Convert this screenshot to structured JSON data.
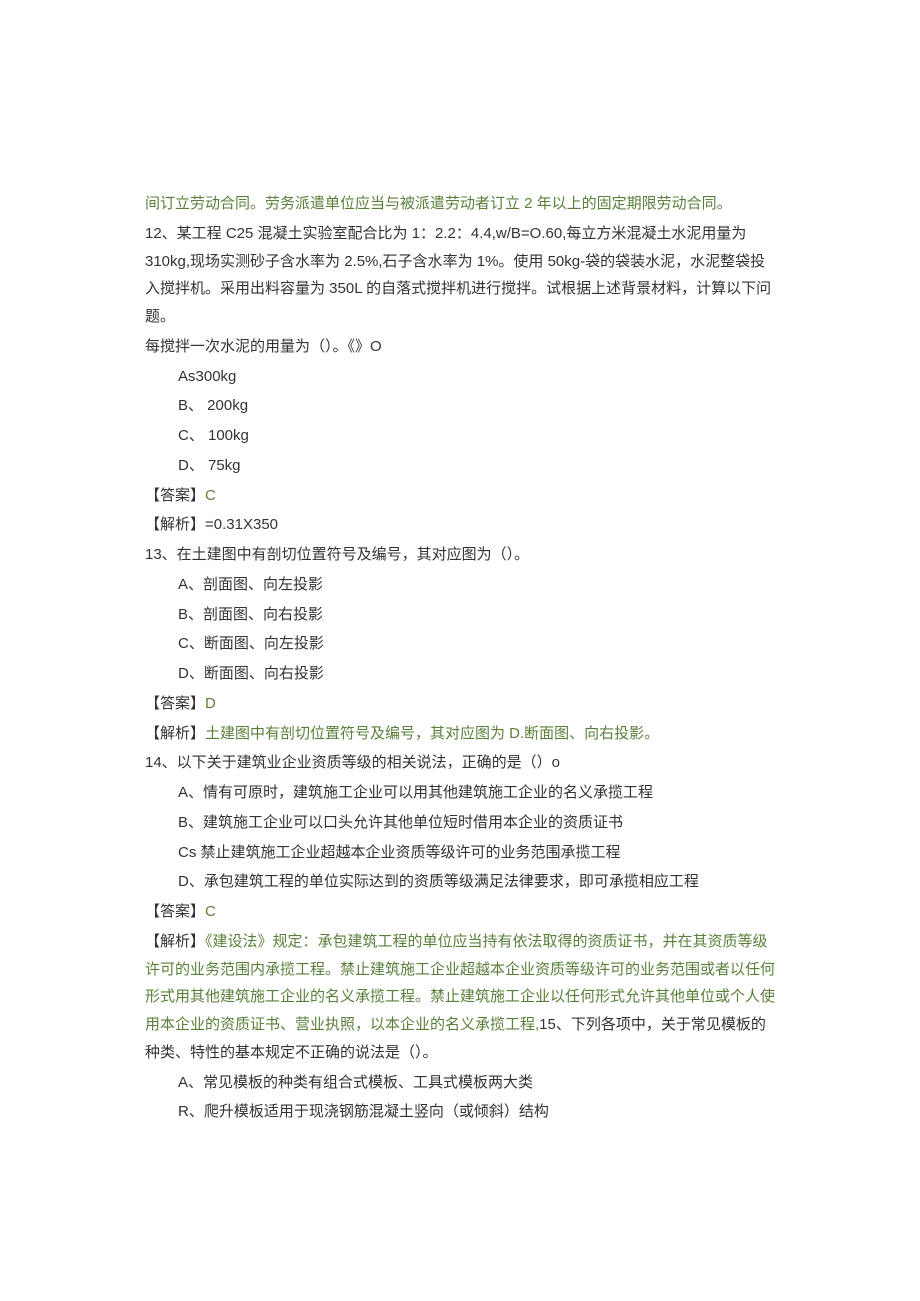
{
  "lines": [
    {
      "cls": "green block",
      "text": "间订立劳动合同。劳务派遣单位应当与被派遣劳动者订立 2 年以上的固定期限劳动合同。"
    },
    {
      "cls": "black block",
      "text": "12、某工程 C25 混凝土实验室配合比为 1：2.2：4.4,w/B=O.60,每立方米混凝土水泥用量为 310kg,现场实测砂子含水率为 2.5%,石子含水率为 1%。使用 50kg-袋的袋装水泥，水泥整袋投入搅拌机。采用出料容量为 350L 的自落式搅拌机进行搅拌。试根据上述背景材料，计算以下问题。"
    },
    {
      "cls": "black block",
      "text": "每搅拌一次水泥的用量为（）。《》O"
    },
    {
      "cls": "black block opt-indent",
      "text": "As300kg"
    },
    {
      "cls": "black block opt-indent",
      "text": "B、 200kg"
    },
    {
      "cls": "black block opt-indent",
      "text": "C、 100kg"
    },
    {
      "cls": "black block opt-indent",
      "text": "D、 75kg"
    },
    {
      "cls": "black block",
      "text": "【答案】",
      "tail": "C",
      "tailCls": "green"
    },
    {
      "cls": "black block",
      "text": "【解析】",
      "tail": "=0.31X350",
      "tailCls": "black"
    },
    {
      "cls": "black block",
      "text": "13、在土建图中有剖切位置符号及编号，其对应图为（）。"
    },
    {
      "cls": "black block opt-indent",
      "text": "A、剖面图、向左投影"
    },
    {
      "cls": "black block opt-indent",
      "text": "B、剖面图、向右投影"
    },
    {
      "cls": "black block opt-indent",
      "text": "C、断面图、向左投影"
    },
    {
      "cls": "black block opt-indent",
      "text": "D、断面图、向右投影"
    },
    {
      "cls": "black block",
      "text": "【答案】",
      "tail": "D",
      "tailCls": "green"
    },
    {
      "cls": "black block",
      "text": "【解析】",
      "tail": "土建图中有剖切位置符号及编号，其对应图为 D.断面图、向右投影。",
      "tailCls": "green"
    },
    {
      "cls": "black block",
      "text": "14、以下关于建筑业企业资质等级的相关说法，正确的是（）o"
    },
    {
      "cls": "black block opt-indent",
      "text": "A、情有可原时，建筑施工企业可以用其他建筑施工企业的名义承揽工程"
    },
    {
      "cls": "black block opt-indent",
      "text": "B、建筑施工企业可以口头允许其他单位短时借用本企业的资质证书"
    },
    {
      "cls": "black block opt-indent",
      "text": "Cs 禁止建筑施工企业超越本企业资质等级许可的业务范围承揽工程"
    },
    {
      "cls": "black block opt-indent",
      "text": "D、承包建筑工程的单位实际达到的资质等级满足法律要求，即可承揽相应工程"
    },
    {
      "cls": "black block",
      "text": "【答案】",
      "tail": "C",
      "tailCls": "green"
    },
    {
      "cls": "block",
      "html": true,
      "segments": [
        {
          "text": "【解析】",
          "cls": "black"
        },
        {
          "text": "《建设法》规定：承包建筑工程的单位应当持有依法取得的资质证书，并在其资质等级许可的业务范围内承揽工程。禁止建筑施工企业超越本企业资质等级许可的业务范围或者以任何形式用其他建筑施工企业的名义承揽工程。禁止建筑施工企业以任何形式允许其他单位或个人使用本企业的资质证书、营业执照，以本企业的名义承揽工程,",
          "cls": "green"
        },
        {
          "text": "15、下列各项中，关于常见模板的种类、特性的基本规定不正确的说法是（）。",
          "cls": "black"
        }
      ]
    },
    {
      "cls": "black block opt-indent",
      "text": "A、常见模板的种类有组合式模板、工具式模板两大类"
    },
    {
      "cls": "black block opt-indent",
      "text": "R、爬升模板适用于现浇钢筋混凝土竖向（或倾斜）结构"
    }
  ]
}
